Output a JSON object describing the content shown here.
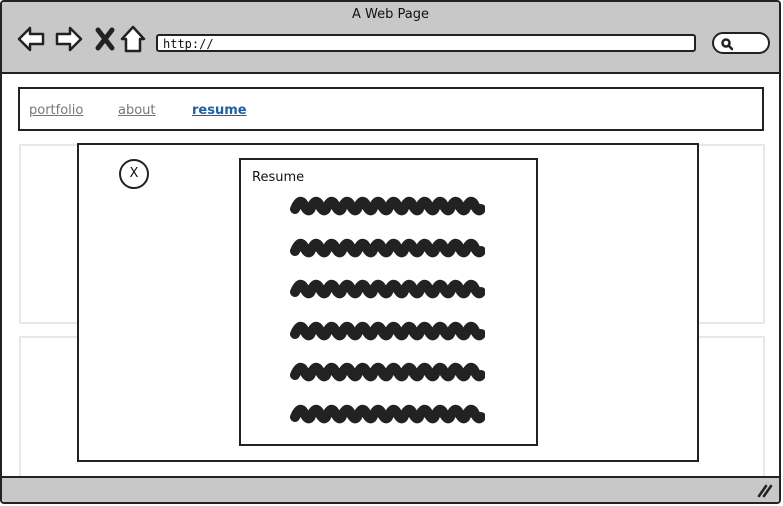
{
  "window": {
    "title": "A Web Page"
  },
  "toolbar": {
    "url": "http://"
  },
  "nav": {
    "links": [
      {
        "label": "portfolio",
        "active": false
      },
      {
        "label": "about",
        "active": false
      },
      {
        "label": "resume",
        "active": true
      }
    ]
  },
  "modal": {
    "close_label": "X",
    "document": {
      "title": "Resume",
      "scribble_lines": 6
    }
  },
  "colors": {
    "chrome": "#c8c8c8",
    "active_link": "#1b5fa8",
    "ink": "#222222"
  }
}
